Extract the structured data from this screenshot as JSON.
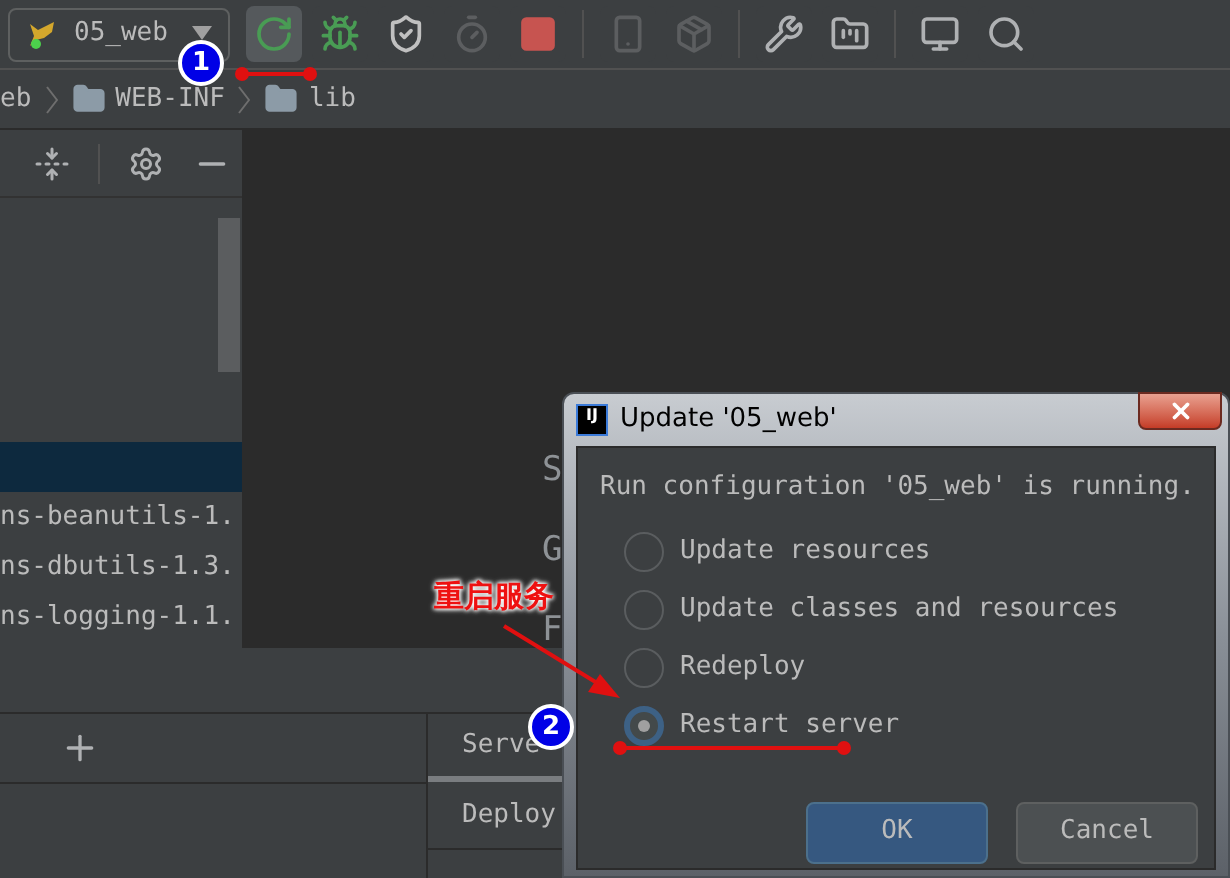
{
  "toolbar": {
    "run_config": "05_web",
    "groups": [
      [
        {
          "kind": "rerun",
          "highlighted": true,
          "disabled": false
        },
        {
          "kind": "debug",
          "highlighted": false,
          "disabled": false
        },
        {
          "kind": "coverage",
          "highlighted": false,
          "disabled": false
        },
        {
          "kind": "profile",
          "highlighted": false,
          "disabled": true
        },
        {
          "kind": "stop",
          "highlighted": false,
          "disabled": false
        }
      ],
      [
        {
          "kind": "device",
          "highlighted": false,
          "disabled": true
        },
        {
          "kind": "deploy",
          "highlighted": false,
          "disabled": true
        }
      ],
      [
        {
          "kind": "wrench",
          "highlighted": false,
          "disabled": false
        },
        {
          "kind": "structure",
          "highlighted": false,
          "disabled": false
        }
      ],
      [
        {
          "kind": "terminal",
          "highlighted": false,
          "disabled": false
        },
        {
          "kind": "search",
          "highlighted": false,
          "disabled": false
        }
      ]
    ]
  },
  "breadcrumb": [
    {
      "label": "eb",
      "kind": "text"
    },
    {
      "label": "WEB-INF",
      "kind": "folder"
    },
    {
      "label": "lib",
      "kind": "folder"
    }
  ],
  "project_tree": {
    "rows": [
      {
        "selected": true
      },
      {
        "label": "ns-beanutils-1.",
        "selected": false
      },
      {
        "label": "ns-dbutils-1.3.",
        "selected": false
      },
      {
        "label": "ns-logging-1.1.",
        "selected": false
      }
    ]
  },
  "editor": {
    "fragments": [
      "S",
      "G",
      "F"
    ]
  },
  "services": {
    "tabs": [
      {
        "label": "Serve",
        "selected": true
      },
      {
        "label": "Deploy",
        "selected": false
      }
    ]
  },
  "dialog": {
    "app_icon": "IJ",
    "title": "Update '05_web'",
    "message": "Run configuration '05_web' is running.",
    "options": [
      {
        "label": "Update resources",
        "selected": false
      },
      {
        "label": "Update classes and resources",
        "selected": false
      },
      {
        "label": "Redeploy",
        "selected": false
      },
      {
        "label": "Restart server",
        "selected": true
      }
    ],
    "buttons": [
      {
        "label": "OK",
        "kind": "primary"
      },
      {
        "label": "Cancel",
        "kind": "secondary"
      }
    ]
  },
  "annotations": {
    "markers": [
      "1",
      "2"
    ],
    "callout": "重启服务"
  }
}
